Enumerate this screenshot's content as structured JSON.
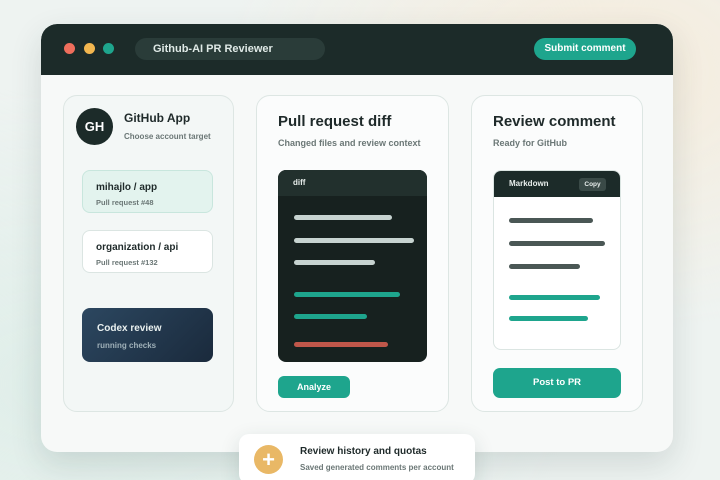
{
  "window": {
    "title": "Github-AI PR Reviewer",
    "submit_label": "Submit comment"
  },
  "left_panel": {
    "avatar_initials": "GH",
    "title": "GitHub App",
    "subtitle": "Choose account target",
    "accounts": [
      {
        "name": "mihajlo / app",
        "pr": "Pull request #48",
        "selected": true
      },
      {
        "name": "organization / api",
        "pr": "Pull request #132",
        "selected": false
      }
    ],
    "codex": {
      "title": "Codex review",
      "status": "running checks"
    }
  },
  "middle_panel": {
    "title": "Pull request diff",
    "subtitle": "Changed files and review context",
    "diff_label": "diff",
    "analyze_label": "Analyze"
  },
  "right_panel": {
    "title": "Review comment",
    "subtitle": "Ready for GitHub",
    "markdown_label": "Markdown",
    "copy_label": "Copy",
    "post_label": "Post to PR"
  },
  "toast": {
    "title": "Review history and quotas",
    "subtitle": "Saved generated comments per account",
    "icon": "plus-icon"
  },
  "colors": {
    "accent": "#1ea58d",
    "dark": "#1c2b29",
    "removed_line": "#c0574a",
    "gold": "#e9b866"
  }
}
